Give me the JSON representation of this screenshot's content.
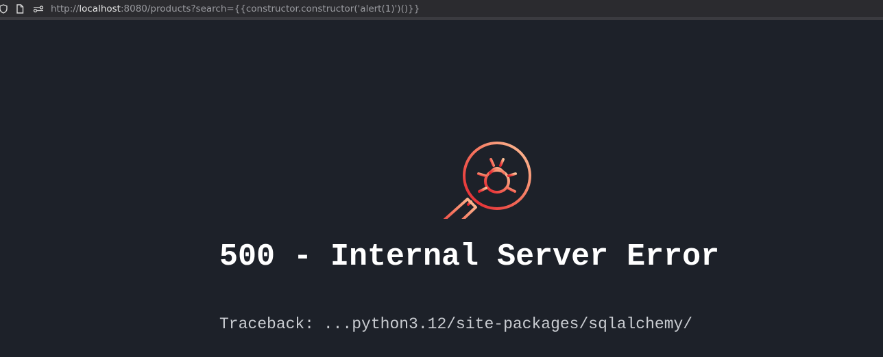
{
  "browser": {
    "url_scheme": "http://",
    "url_host": "localhost",
    "url_rest": ":8080/products?search={{constructor.constructor('alert(1)')()}}",
    "icons": [
      "shield-icon",
      "page-icon",
      "permissions-icon"
    ]
  },
  "error": {
    "icon": "bug-magnifier-icon",
    "title": "500 - Internal Server Error",
    "traceback": "Traceback: ...python3.12/site-packages/sqlalchemy/"
  },
  "colors": {
    "background": "#1d2129",
    "icon_gradient_start": "#e11d2a",
    "icon_gradient_end": "#fcc49a"
  }
}
